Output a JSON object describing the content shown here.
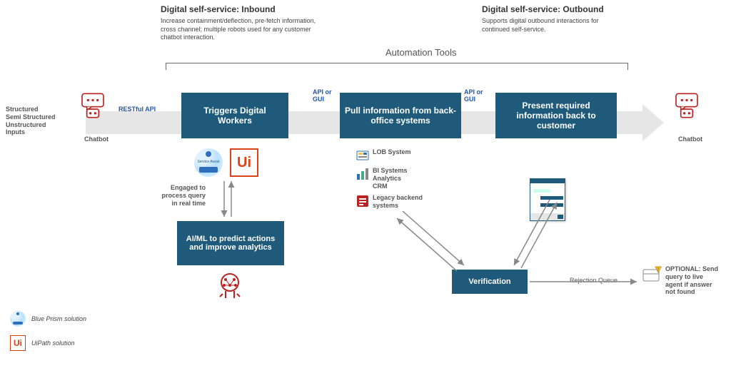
{
  "top_labels": {
    "inbound_title": "Digital self-service: Inbound",
    "inbound_desc": "Increase containment/deflection, pre-fetch information, cross channel; multiple robots used for any customer chatbot interaction.",
    "outbound_title": "Digital self-service: Outbound",
    "outbound_desc": "Supports digital outbound interactions for continued self-service."
  },
  "tools_title": "Automation Tools",
  "left_inputs": "Structured\nSemi Structured\nUnstructured Inputs",
  "chatbot_label_left": "Chatbot",
  "chatbot_label_right": "Chatbot",
  "connector_labels": {
    "restful": "RESTful API",
    "api_gui_1": "API or GUI",
    "api_gui_2": "API or GUI"
  },
  "boxes": {
    "triggers": "Triggers Digital Workers",
    "pull": "Pull information from back-office systems",
    "present": "Present required information back to customer",
    "aiml": "AI/ML to predict actions and improve analytics",
    "verification": "Verification"
  },
  "service_assist_label": "Service Assist",
  "engaged_label": "Engaged to process query in real time",
  "systems": {
    "lob": "LOB System",
    "bi": "BI Systems\nAnalytics\nCRM",
    "legacy": "Legacy backend systems"
  },
  "rejection_label": "Rejection  Queue",
  "optional_label": "OPTIONAL: Send query to live agent if answer not found",
  "legend": {
    "blueprism": "Blue Prism solution",
    "uipath": "UiPath solution"
  },
  "colors": {
    "box_bg": "#1f5a7a",
    "grey": "#e6e6e6",
    "accent_blue": "#2d6fbd",
    "ui_orange": "#d84315"
  },
  "chart_data": {
    "type": "diagram",
    "flow": [
      {
        "from": "Chatbot (inbound)",
        "to": "Triggers Digital Workers",
        "via": "RESTful API"
      },
      {
        "from": "Triggers Digital Workers",
        "to": "Pull information from back-office systems",
        "via": "API or GUI"
      },
      {
        "from": "Pull information from back-office systems",
        "to": "Present required information back to customer",
        "via": "API or GUI"
      },
      {
        "from": "Present required information back to customer",
        "to": "Chatbot (outbound)"
      },
      {
        "from": "Triggers Digital Workers",
        "to": "AI/ML to predict actions and improve analytics",
        "bidirectional": true,
        "note": "Engaged to process query in real time"
      },
      {
        "from": "Pull information from back-office systems",
        "to": "Verification",
        "bidirectional": true
      },
      {
        "from": "Present required information back to customer",
        "to": "Verification",
        "bidirectional": true
      },
      {
        "from": "Verification",
        "to": "Rejection Queue / Live agent (optional)"
      }
    ],
    "back_office_systems": [
      "LOB System",
      "BI Systems / Analytics / CRM",
      "Legacy backend systems"
    ],
    "solutions": [
      "Blue Prism (Service Assist)",
      "UiPath"
    ]
  }
}
